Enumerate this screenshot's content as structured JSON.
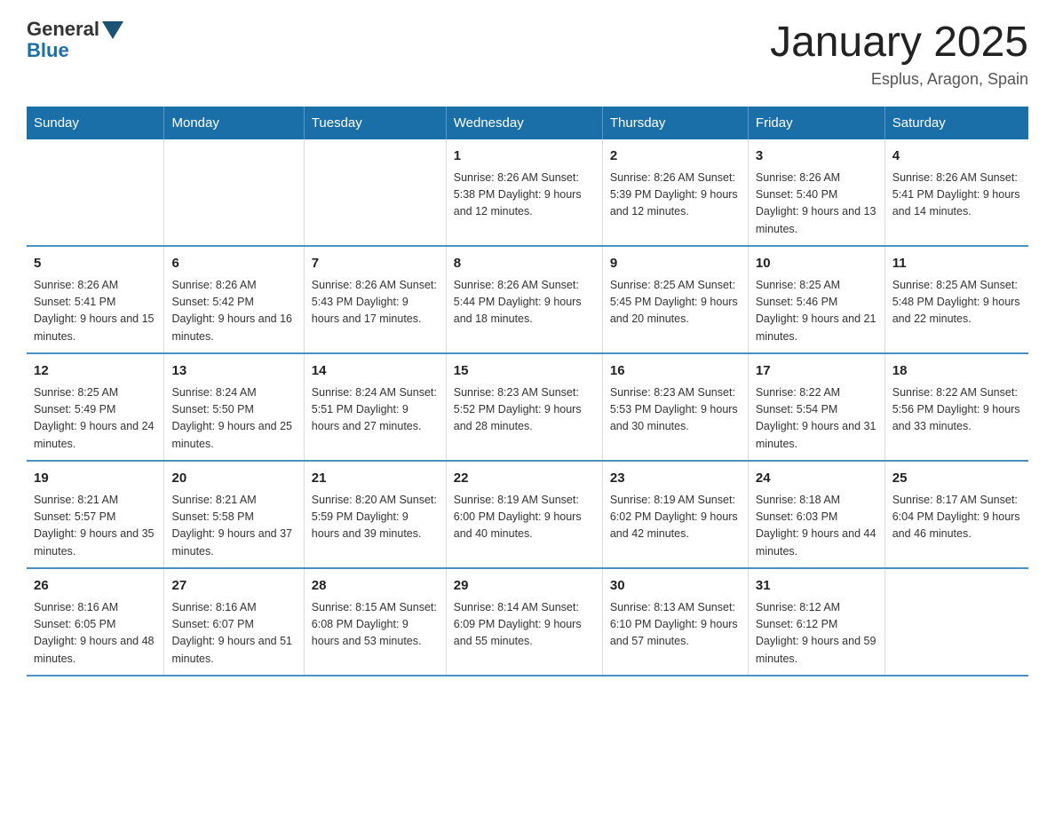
{
  "header": {
    "logo_general": "General",
    "logo_blue": "Blue",
    "title": "January 2025",
    "subtitle": "Esplus, Aragon, Spain"
  },
  "weekdays": [
    "Sunday",
    "Monday",
    "Tuesday",
    "Wednesday",
    "Thursday",
    "Friday",
    "Saturday"
  ],
  "weeks": [
    [
      {
        "day": "",
        "info": ""
      },
      {
        "day": "",
        "info": ""
      },
      {
        "day": "",
        "info": ""
      },
      {
        "day": "1",
        "info": "Sunrise: 8:26 AM\nSunset: 5:38 PM\nDaylight: 9 hours\nand 12 minutes."
      },
      {
        "day": "2",
        "info": "Sunrise: 8:26 AM\nSunset: 5:39 PM\nDaylight: 9 hours\nand 12 minutes."
      },
      {
        "day": "3",
        "info": "Sunrise: 8:26 AM\nSunset: 5:40 PM\nDaylight: 9 hours\nand 13 minutes."
      },
      {
        "day": "4",
        "info": "Sunrise: 8:26 AM\nSunset: 5:41 PM\nDaylight: 9 hours\nand 14 minutes."
      }
    ],
    [
      {
        "day": "5",
        "info": "Sunrise: 8:26 AM\nSunset: 5:41 PM\nDaylight: 9 hours\nand 15 minutes."
      },
      {
        "day": "6",
        "info": "Sunrise: 8:26 AM\nSunset: 5:42 PM\nDaylight: 9 hours\nand 16 minutes."
      },
      {
        "day": "7",
        "info": "Sunrise: 8:26 AM\nSunset: 5:43 PM\nDaylight: 9 hours\nand 17 minutes."
      },
      {
        "day": "8",
        "info": "Sunrise: 8:26 AM\nSunset: 5:44 PM\nDaylight: 9 hours\nand 18 minutes."
      },
      {
        "day": "9",
        "info": "Sunrise: 8:25 AM\nSunset: 5:45 PM\nDaylight: 9 hours\nand 20 minutes."
      },
      {
        "day": "10",
        "info": "Sunrise: 8:25 AM\nSunset: 5:46 PM\nDaylight: 9 hours\nand 21 minutes."
      },
      {
        "day": "11",
        "info": "Sunrise: 8:25 AM\nSunset: 5:48 PM\nDaylight: 9 hours\nand 22 minutes."
      }
    ],
    [
      {
        "day": "12",
        "info": "Sunrise: 8:25 AM\nSunset: 5:49 PM\nDaylight: 9 hours\nand 24 minutes."
      },
      {
        "day": "13",
        "info": "Sunrise: 8:24 AM\nSunset: 5:50 PM\nDaylight: 9 hours\nand 25 minutes."
      },
      {
        "day": "14",
        "info": "Sunrise: 8:24 AM\nSunset: 5:51 PM\nDaylight: 9 hours\nand 27 minutes."
      },
      {
        "day": "15",
        "info": "Sunrise: 8:23 AM\nSunset: 5:52 PM\nDaylight: 9 hours\nand 28 minutes."
      },
      {
        "day": "16",
        "info": "Sunrise: 8:23 AM\nSunset: 5:53 PM\nDaylight: 9 hours\nand 30 minutes."
      },
      {
        "day": "17",
        "info": "Sunrise: 8:22 AM\nSunset: 5:54 PM\nDaylight: 9 hours\nand 31 minutes."
      },
      {
        "day": "18",
        "info": "Sunrise: 8:22 AM\nSunset: 5:56 PM\nDaylight: 9 hours\nand 33 minutes."
      }
    ],
    [
      {
        "day": "19",
        "info": "Sunrise: 8:21 AM\nSunset: 5:57 PM\nDaylight: 9 hours\nand 35 minutes."
      },
      {
        "day": "20",
        "info": "Sunrise: 8:21 AM\nSunset: 5:58 PM\nDaylight: 9 hours\nand 37 minutes."
      },
      {
        "day": "21",
        "info": "Sunrise: 8:20 AM\nSunset: 5:59 PM\nDaylight: 9 hours\nand 39 minutes."
      },
      {
        "day": "22",
        "info": "Sunrise: 8:19 AM\nSunset: 6:00 PM\nDaylight: 9 hours\nand 40 minutes."
      },
      {
        "day": "23",
        "info": "Sunrise: 8:19 AM\nSunset: 6:02 PM\nDaylight: 9 hours\nand 42 minutes."
      },
      {
        "day": "24",
        "info": "Sunrise: 8:18 AM\nSunset: 6:03 PM\nDaylight: 9 hours\nand 44 minutes."
      },
      {
        "day": "25",
        "info": "Sunrise: 8:17 AM\nSunset: 6:04 PM\nDaylight: 9 hours\nand 46 minutes."
      }
    ],
    [
      {
        "day": "26",
        "info": "Sunrise: 8:16 AM\nSunset: 6:05 PM\nDaylight: 9 hours\nand 48 minutes."
      },
      {
        "day": "27",
        "info": "Sunrise: 8:16 AM\nSunset: 6:07 PM\nDaylight: 9 hours\nand 51 minutes."
      },
      {
        "day": "28",
        "info": "Sunrise: 8:15 AM\nSunset: 6:08 PM\nDaylight: 9 hours\nand 53 minutes."
      },
      {
        "day": "29",
        "info": "Sunrise: 8:14 AM\nSunset: 6:09 PM\nDaylight: 9 hours\nand 55 minutes."
      },
      {
        "day": "30",
        "info": "Sunrise: 8:13 AM\nSunset: 6:10 PM\nDaylight: 9 hours\nand 57 minutes."
      },
      {
        "day": "31",
        "info": "Sunrise: 8:12 AM\nSunset: 6:12 PM\nDaylight: 9 hours\nand 59 minutes."
      },
      {
        "day": "",
        "info": ""
      }
    ]
  ]
}
